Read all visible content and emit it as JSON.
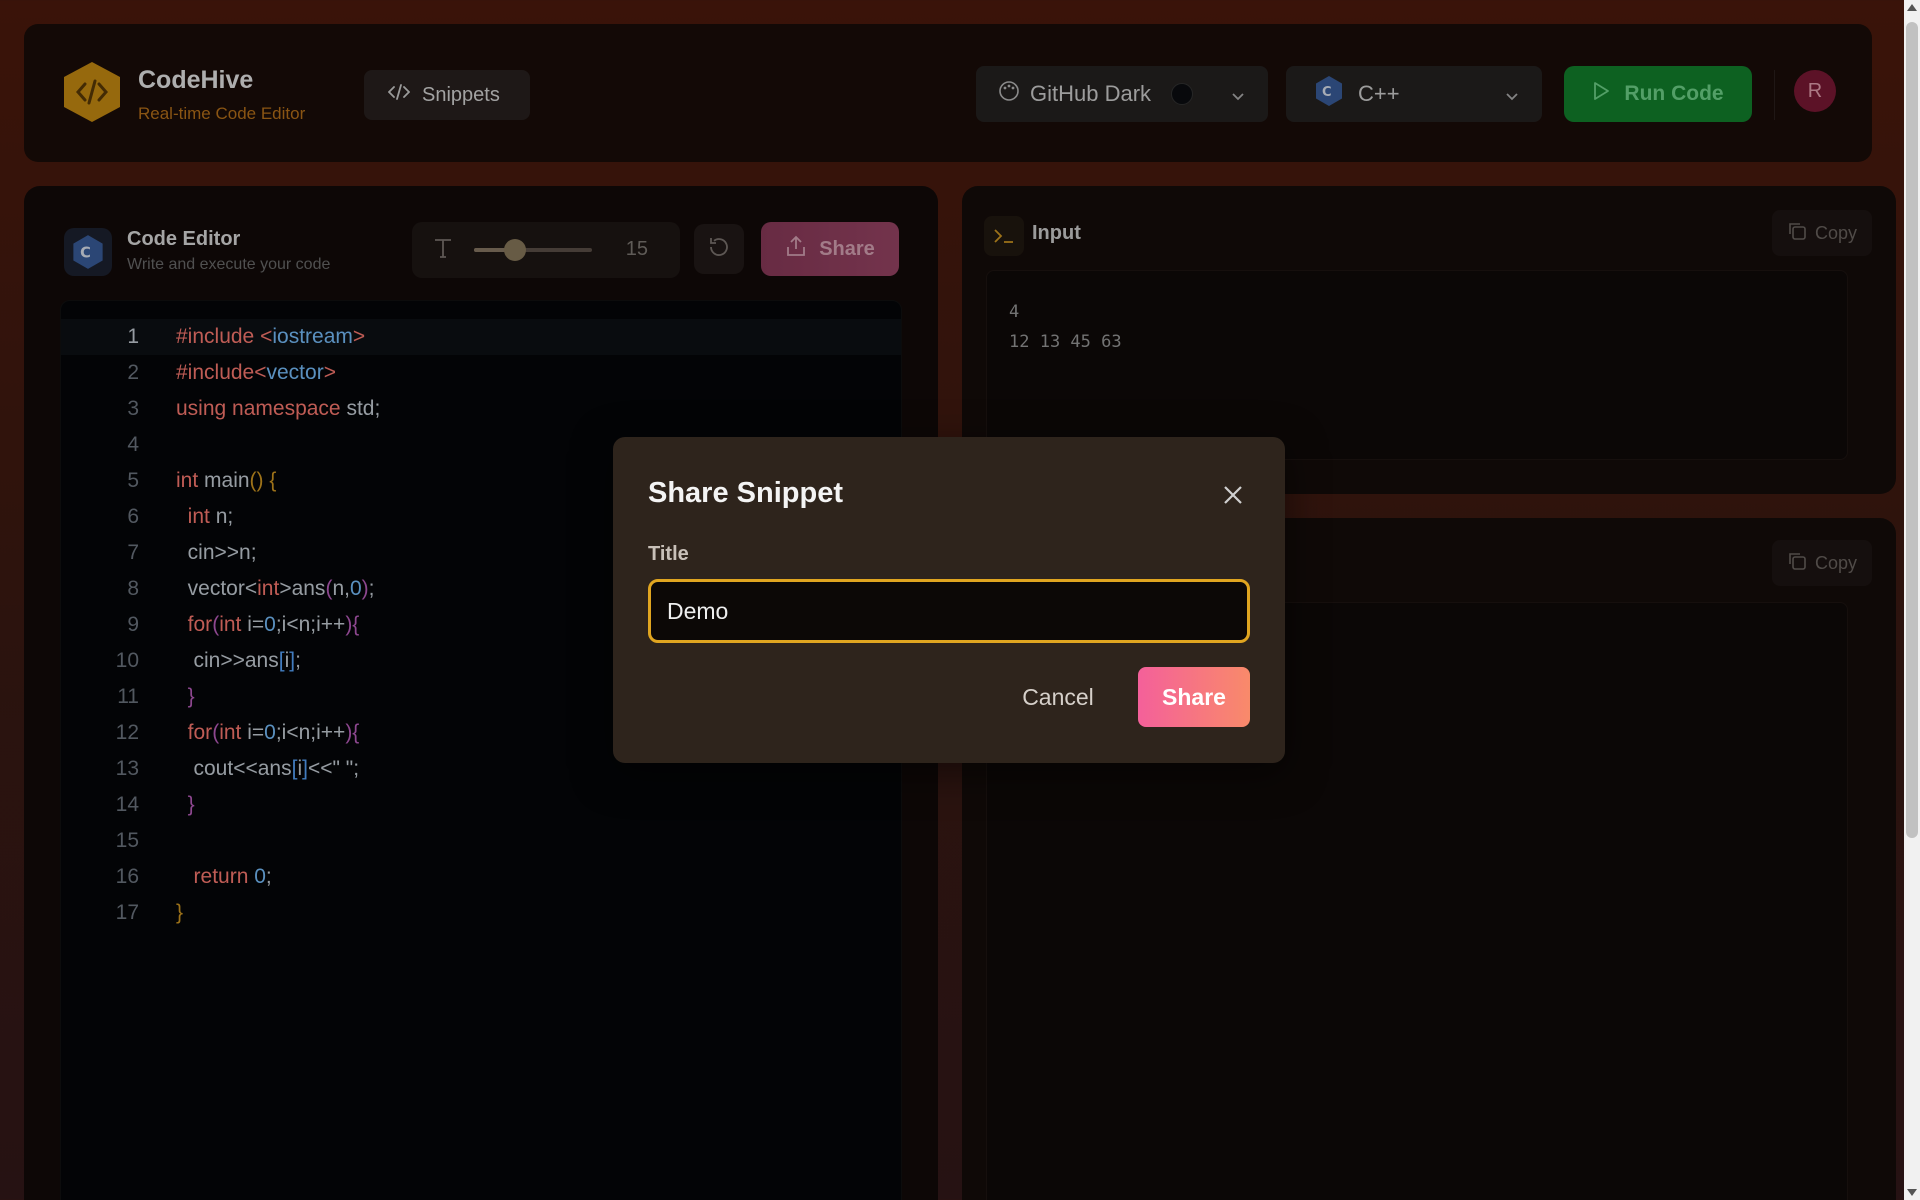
{
  "header": {
    "brand_title": "CodeHive",
    "brand_subtitle": "Real-time Code Editor",
    "snippets_label": "Snippets",
    "theme_label": "GitHub Dark",
    "language_label": "C++",
    "run_label": "Run Code",
    "avatar_initial": "R"
  },
  "editor": {
    "title": "Code Editor",
    "subtitle": "Write and execute your code",
    "font_size": "15",
    "font_size_fraction": 0.35,
    "share_label": "Share",
    "lines": [
      "1",
      "2",
      "3",
      "4",
      "5",
      "6",
      "7",
      "8",
      "9",
      "10",
      "11",
      "12",
      "13",
      "14",
      "15",
      "16",
      "17"
    ]
  },
  "input_panel": {
    "title": "Input",
    "copy_label": "Copy",
    "value": "4\n12 13 45 63"
  },
  "output_panel": {
    "copy_label": "Copy"
  },
  "modal": {
    "title": "Share Snippet",
    "field_label": "Title",
    "field_value": "Demo",
    "cancel_label": "Cancel",
    "share_label": "Share"
  },
  "colors": {
    "accent_run": "#12822d",
    "accent_share": "#f4609a",
    "input_focus": "#e0a520",
    "brand_gold": "#c98d12"
  }
}
